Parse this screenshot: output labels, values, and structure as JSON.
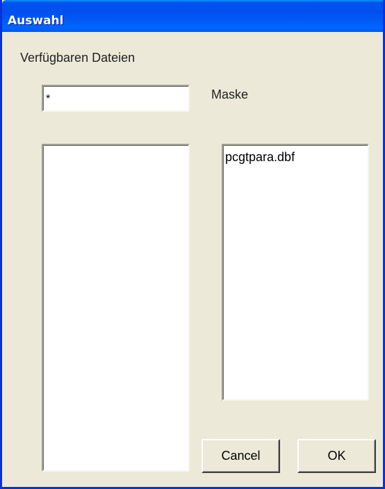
{
  "window": {
    "title": "Auswahl"
  },
  "dialog": {
    "heading": "Verfügbaren Dateien",
    "mask_label": "Maske",
    "mask_value": "*"
  },
  "lists": {
    "left": {
      "items": []
    },
    "right": {
      "items": [
        "pcgtpara.dbf"
      ]
    }
  },
  "buttons": {
    "cancel": "Cancel",
    "ok": "OK"
  }
}
